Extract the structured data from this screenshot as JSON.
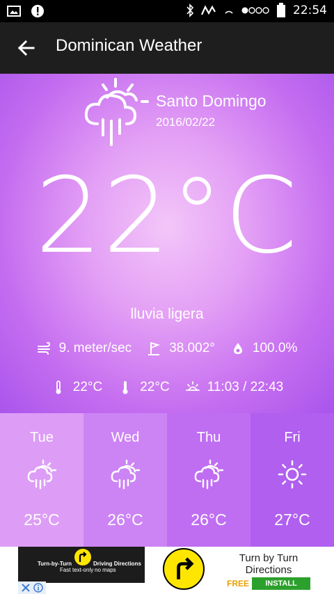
{
  "status_bar": {
    "time": "22:54"
  },
  "app_bar": {
    "title": "Dominican Weather"
  },
  "location": {
    "city": "Santo Domingo",
    "date": "2016/02/22"
  },
  "current": {
    "temperature": "22°C",
    "description": "lluvia ligera",
    "wind": "9. meter/sec",
    "wind_direction": "38.002°",
    "humidity": "100.0%",
    "temp_min": "22°C",
    "temp_max": "22°C",
    "sun_times": "11:03 / 22:43"
  },
  "forecast": [
    {
      "day": "Tue",
      "temp": "25°C",
      "icon": "cloud-rain-sun-icon",
      "bg": "#dd9df7"
    },
    {
      "day": "Wed",
      "temp": "26°C",
      "icon": "cloud-rain-sun-icon",
      "bg": "#cc84f4"
    },
    {
      "day": "Thu",
      "temp": "26°C",
      "icon": "cloud-rain-sun-icon",
      "bg": "#bf6ef2"
    },
    {
      "day": "Fri",
      "temp": "27°C",
      "icon": "sun-icon",
      "bg": "#b05fef"
    }
  ],
  "ad": {
    "banner_left_title": "Turn-by-Turn",
    "banner_left_sub": "Driving Directions",
    "banner_left_note1": "Fast",
    "banner_left_note2": "text-only",
    "banner_left_note3": "no maps",
    "title": "Turn by Turn Directions",
    "free_label": "FREE",
    "install_label": "INSTALL"
  },
  "colors": {
    "app_bar": "#1e1e1e",
    "accent": "#c56df0"
  }
}
